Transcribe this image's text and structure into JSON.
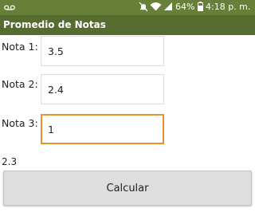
{
  "status_bar": {
    "voicemail_icon": "voicemail-icon",
    "silent_icon": "silent-icon",
    "wifi_icon": "wifi-icon",
    "signal_icon": "signal-icon",
    "battery_level": "64%",
    "time": "4:18 p. m."
  },
  "app": {
    "title": "Promedio de Notas"
  },
  "form": {
    "nota1": {
      "label": "Nota 1:",
      "value": "3.5"
    },
    "nota2": {
      "label": "Nota 2:",
      "value": "2.4"
    },
    "nota3": {
      "label": "Nota 3:",
      "value": "1"
    }
  },
  "result": "2.3",
  "button": {
    "label": "Calcular"
  },
  "colors": {
    "status_bar": "#687f3a",
    "app_bar": "#556b2f",
    "focus": "#e8912f"
  }
}
